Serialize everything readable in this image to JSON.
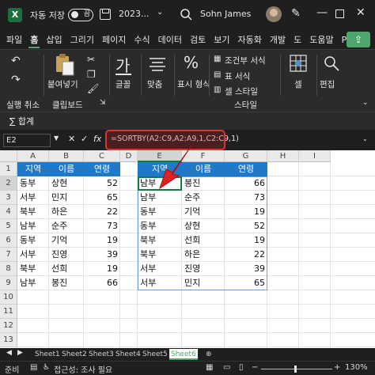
{
  "titlebar": {
    "logo": "X",
    "autosave_label": "자동 저장",
    "toggle_label": "끔",
    "filename": "2023...",
    "username": "Sohn James"
  },
  "tabs": [
    "파일",
    "홈",
    "삽입",
    "그리기",
    "페이지",
    "수식",
    "데이터",
    "검토",
    "보기",
    "자동화",
    "개발",
    "도",
    "도움말",
    "Power"
  ],
  "ribbon": {
    "undo_label": "실행 취소",
    "paste_label": "붙여넣기",
    "clipboard_label": "클립보드",
    "font_label": "글꼴",
    "align_label": "맞춤",
    "number_label": "표시 형식",
    "cond_format_label": "조건부 서식",
    "table_format_label": "표 서식",
    "cell_style_label": "셀 스타일",
    "style_group_label": "스타일",
    "cells_label": "셀",
    "edit_label": "편집"
  },
  "sum_label": "∑ 합계",
  "formula_bar": {
    "name_box": "E2",
    "formula": "=SORTBY(A2:C9,A2:A9,1,C2:C9,1)"
  },
  "grid": {
    "columns": [
      "A",
      "B",
      "C",
      "D",
      "E",
      "F",
      "G",
      "H",
      "I"
    ],
    "rows": [
      "1",
      "2",
      "3",
      "4",
      "5",
      "6",
      "7",
      "8",
      "9",
      "10",
      "11",
      "12",
      "13"
    ],
    "left_table": {
      "headers": [
        "지역",
        "이름",
        "연령"
      ],
      "rows": [
        [
          "동부",
          "상현",
          "52"
        ],
        [
          "서부",
          "민지",
          "65"
        ],
        [
          "북부",
          "하은",
          "22"
        ],
        [
          "남부",
          "순주",
          "73"
        ],
        [
          "동부",
          "기억",
          "19"
        ],
        [
          "서부",
          "진영",
          "39"
        ],
        [
          "북부",
          "선희",
          "19"
        ],
        [
          "남부",
          "봉진",
          "66"
        ]
      ]
    },
    "right_table": {
      "headers": [
        "지역",
        "이름",
        "연령"
      ],
      "rows": [
        [
          "남부",
          "봉진",
          "66"
        ],
        [
          "남부",
          "순주",
          "73"
        ],
        [
          "동부",
          "기억",
          "19"
        ],
        [
          "동부",
          "상현",
          "52"
        ],
        [
          "북부",
          "선희",
          "19"
        ],
        [
          "북부",
          "하은",
          "22"
        ],
        [
          "서부",
          "진영",
          "39"
        ],
        [
          "서부",
          "민지",
          "65"
        ]
      ]
    }
  },
  "sheets": [
    "Sheet1",
    "Sheet2",
    "Sheet3",
    "Sheet4",
    "Sheet5",
    "Sheet6"
  ],
  "active_sheet": "Sheet6",
  "statusbar": {
    "ready": "준비",
    "accessibility": "접근성: 조사 필요",
    "zoom": "130%"
  },
  "colors": {
    "accent": "#4ea66e",
    "table_header": "#1f78c8",
    "callout": "#dd3333"
  }
}
